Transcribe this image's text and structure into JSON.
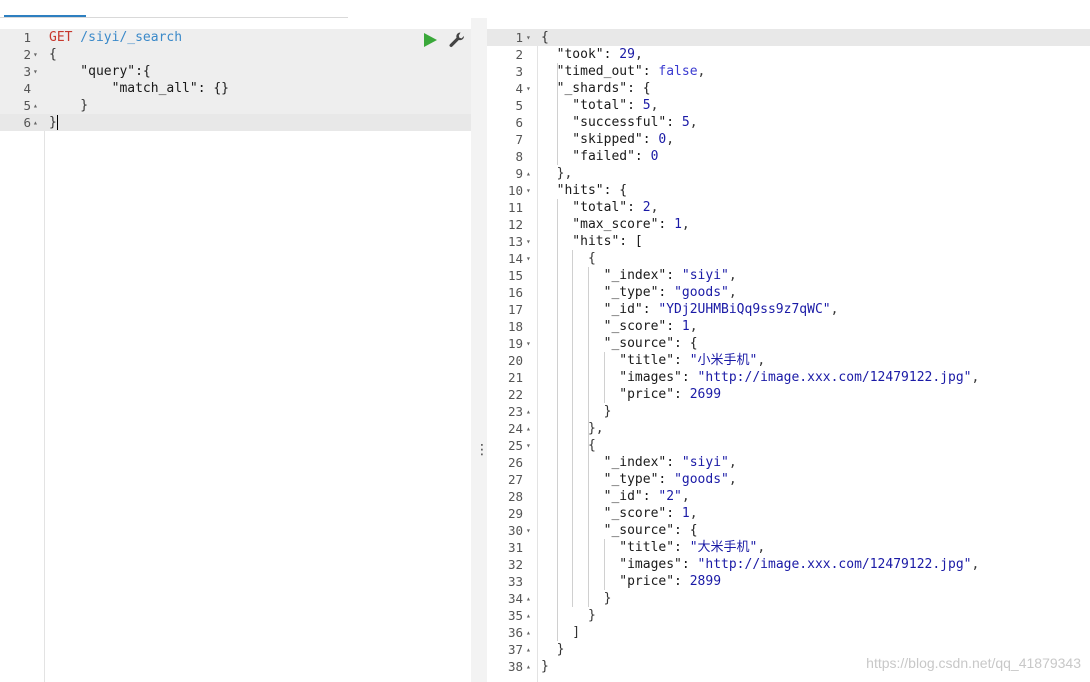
{
  "tabs": {
    "partial_label": "..."
  },
  "request": {
    "lines": [
      {
        "n": "1",
        "fold": "",
        "parts": [
          [
            "GET",
            "red"
          ],
          [
            " /siyi/_search",
            "blue"
          ]
        ]
      },
      {
        "n": "2",
        "fold": "▾",
        "parts": [
          [
            "{",
            "punc"
          ]
        ]
      },
      {
        "n": "3",
        "fold": "▾",
        "parts": [
          [
            "    \"query\":{",
            "key"
          ]
        ]
      },
      {
        "n": "4",
        "fold": "",
        "parts": [
          [
            "        \"match_all\": {}",
            "key"
          ]
        ]
      },
      {
        "n": "5",
        "fold": "▴",
        "parts": [
          [
            "    }",
            "punc"
          ]
        ]
      },
      {
        "n": "6",
        "fold": "▴",
        "parts": [
          [
            "}",
            "punc"
          ]
        ]
      }
    ]
  },
  "response": {
    "lines": [
      {
        "n": "1",
        "fold": "▾",
        "parts": [
          [
            "{",
            "punc"
          ]
        ]
      },
      {
        "n": "2",
        "fold": "",
        "parts": [
          [
            "  \"took\": ",
            "key"
          ],
          [
            "29",
            "val"
          ],
          [
            ",",
            "punc"
          ]
        ]
      },
      {
        "n": "3",
        "fold": "",
        "parts": [
          [
            "  \"timed_out\": ",
            "key"
          ],
          [
            "false",
            "bool"
          ],
          [
            ",",
            "punc"
          ]
        ]
      },
      {
        "n": "4",
        "fold": "▾",
        "parts": [
          [
            "  \"_shards\": {",
            "key"
          ]
        ]
      },
      {
        "n": "5",
        "fold": "",
        "parts": [
          [
            "    \"total\": ",
            "key"
          ],
          [
            "5",
            "val"
          ],
          [
            ",",
            "punc"
          ]
        ]
      },
      {
        "n": "6",
        "fold": "",
        "parts": [
          [
            "    \"successful\": ",
            "key"
          ],
          [
            "5",
            "val"
          ],
          [
            ",",
            "punc"
          ]
        ]
      },
      {
        "n": "7",
        "fold": "",
        "parts": [
          [
            "    \"skipped\": ",
            "key"
          ],
          [
            "0",
            "val"
          ],
          [
            ",",
            "punc"
          ]
        ]
      },
      {
        "n": "8",
        "fold": "",
        "parts": [
          [
            "    \"failed\": ",
            "key"
          ],
          [
            "0",
            "val"
          ]
        ]
      },
      {
        "n": "9",
        "fold": "▴",
        "parts": [
          [
            "  },",
            "punc"
          ]
        ]
      },
      {
        "n": "10",
        "fold": "▾",
        "parts": [
          [
            "  \"hits\": {",
            "key"
          ]
        ]
      },
      {
        "n": "11",
        "fold": "",
        "parts": [
          [
            "    \"total\": ",
            "key"
          ],
          [
            "2",
            "val"
          ],
          [
            ",",
            "punc"
          ]
        ]
      },
      {
        "n": "12",
        "fold": "",
        "parts": [
          [
            "    \"max_score\": ",
            "key"
          ],
          [
            "1",
            "val"
          ],
          [
            ",",
            "punc"
          ]
        ]
      },
      {
        "n": "13",
        "fold": "▾",
        "parts": [
          [
            "    \"hits\": [",
            "key"
          ]
        ]
      },
      {
        "n": "14",
        "fold": "▾",
        "parts": [
          [
            "      {",
            "punc"
          ]
        ]
      },
      {
        "n": "15",
        "fold": "",
        "parts": [
          [
            "        \"_index\": ",
            "key"
          ],
          [
            "\"siyi\"",
            "str"
          ],
          [
            ",",
            "punc"
          ]
        ]
      },
      {
        "n": "16",
        "fold": "",
        "parts": [
          [
            "        \"_type\": ",
            "key"
          ],
          [
            "\"goods\"",
            "str"
          ],
          [
            ",",
            "punc"
          ]
        ]
      },
      {
        "n": "17",
        "fold": "",
        "parts": [
          [
            "        \"_id\": ",
            "key"
          ],
          [
            "\"YDj2UHMBiQq9ss9z7qWC\"",
            "str"
          ],
          [
            ",",
            "punc"
          ]
        ]
      },
      {
        "n": "18",
        "fold": "",
        "parts": [
          [
            "        \"_score\": ",
            "key"
          ],
          [
            "1",
            "val"
          ],
          [
            ",",
            "punc"
          ]
        ]
      },
      {
        "n": "19",
        "fold": "▾",
        "parts": [
          [
            "        \"_source\": {",
            "key"
          ]
        ]
      },
      {
        "n": "20",
        "fold": "",
        "parts": [
          [
            "          \"title\": ",
            "key"
          ],
          [
            "\"小米手机\"",
            "str"
          ],
          [
            ",",
            "punc"
          ]
        ]
      },
      {
        "n": "21",
        "fold": "",
        "parts": [
          [
            "          \"images\": ",
            "key"
          ],
          [
            "\"http://image.xxx.com/12479122.jpg\"",
            "str"
          ],
          [
            ",",
            "punc"
          ]
        ]
      },
      {
        "n": "22",
        "fold": "",
        "parts": [
          [
            "          \"price\": ",
            "key"
          ],
          [
            "2699",
            "val"
          ]
        ]
      },
      {
        "n": "23",
        "fold": "▴",
        "parts": [
          [
            "        }",
            "punc"
          ]
        ]
      },
      {
        "n": "24",
        "fold": "▴",
        "parts": [
          [
            "      },",
            "punc"
          ]
        ]
      },
      {
        "n": "25",
        "fold": "▾",
        "parts": [
          [
            "      {",
            "punc"
          ]
        ]
      },
      {
        "n": "26",
        "fold": "",
        "parts": [
          [
            "        \"_index\": ",
            "key"
          ],
          [
            "\"siyi\"",
            "str"
          ],
          [
            ",",
            "punc"
          ]
        ]
      },
      {
        "n": "27",
        "fold": "",
        "parts": [
          [
            "        \"_type\": ",
            "key"
          ],
          [
            "\"goods\"",
            "str"
          ],
          [
            ",",
            "punc"
          ]
        ]
      },
      {
        "n": "28",
        "fold": "",
        "parts": [
          [
            "        \"_id\": ",
            "key"
          ],
          [
            "\"2\"",
            "str"
          ],
          [
            ",",
            "punc"
          ]
        ]
      },
      {
        "n": "29",
        "fold": "",
        "parts": [
          [
            "        \"_score\": ",
            "key"
          ],
          [
            "1",
            "val"
          ],
          [
            ",",
            "punc"
          ]
        ]
      },
      {
        "n": "30",
        "fold": "▾",
        "parts": [
          [
            "        \"_source\": {",
            "key"
          ]
        ]
      },
      {
        "n": "31",
        "fold": "",
        "parts": [
          [
            "          \"title\": ",
            "key"
          ],
          [
            "\"大米手机\"",
            "str"
          ],
          [
            ",",
            "punc"
          ]
        ]
      },
      {
        "n": "32",
        "fold": "",
        "parts": [
          [
            "          \"images\": ",
            "key"
          ],
          [
            "\"http://image.xxx.com/12479122.jpg\"",
            "str"
          ],
          [
            ",",
            "punc"
          ]
        ]
      },
      {
        "n": "33",
        "fold": "",
        "parts": [
          [
            "          \"price\": ",
            "key"
          ],
          [
            "2899",
            "val"
          ]
        ]
      },
      {
        "n": "34",
        "fold": "▴",
        "parts": [
          [
            "        }",
            "punc"
          ]
        ]
      },
      {
        "n": "35",
        "fold": "▴",
        "parts": [
          [
            "      }",
            "punc"
          ]
        ]
      },
      {
        "n": "36",
        "fold": "▴",
        "parts": [
          [
            "    ]",
            "punc"
          ]
        ]
      },
      {
        "n": "37",
        "fold": "▴",
        "parts": [
          [
            "  }",
            "punc"
          ]
        ]
      },
      {
        "n": "38",
        "fold": "▴",
        "parts": [
          [
            "}",
            "punc"
          ]
        ]
      }
    ]
  },
  "icons": {
    "run": "play-icon",
    "settings": "wrench-icon",
    "divider": "vertical-ellipsis-icon"
  },
  "colors": {
    "method": "#c7382d",
    "path": "#3a89c9",
    "run": "#3aa83a",
    "active_line": "#e8e8e8"
  },
  "watermark": "https://blog.csdn.net/qq_41879343"
}
